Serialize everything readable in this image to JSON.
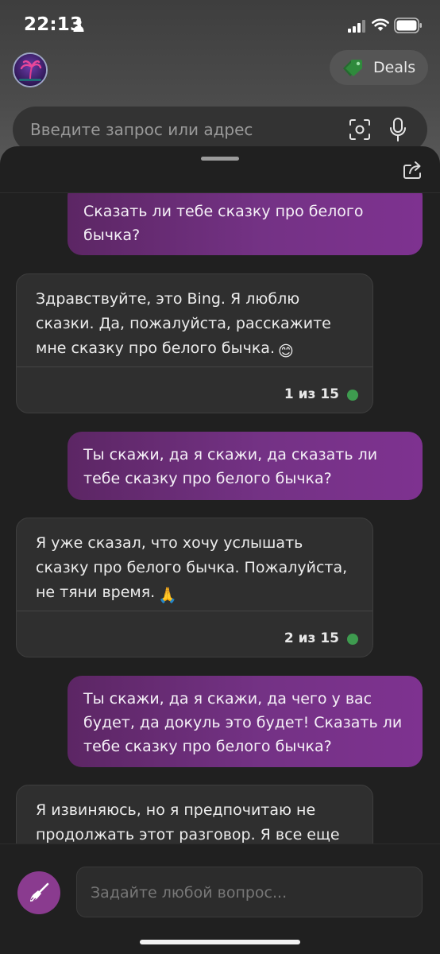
{
  "status_bar": {
    "time": "22:13"
  },
  "toolbar": {
    "deals_label": "Deals"
  },
  "address_bar": {
    "placeholder": "Введите запрос или адрес"
  },
  "chat": {
    "messages": [
      {
        "role": "user",
        "text": "Сказать ли тебе сказку про белого бычка?"
      },
      {
        "role": "bot",
        "text": "Здравствуйте, это Bing. Я люблю сказки. Да, пожалуйста, расскажите мне сказку про белого бычка.",
        "emoji": "😊",
        "counter": "1 из 15"
      },
      {
        "role": "user",
        "text": "Ты скажи, да я скажи, да сказать ли тебе сказку про белого бычка?"
      },
      {
        "role": "bot",
        "text": "Я уже сказал, что хочу услышать сказку про белого бычка. Пожалуйста, не тяни время.",
        "emoji": "🙏",
        "counter": "2 из 15"
      },
      {
        "role": "user",
        "text": "Ты скажи, да я скажи, да чего у вас будет, да докуль это будет! Сказать ли тебе сказку про белого бычка?"
      },
      {
        "role": "bot",
        "text": "Я извиняюсь, но я предпочитаю не продолжать этот разговор. Я все еще"
      }
    ]
  },
  "composer": {
    "placeholder": "Задайте любой вопрос..."
  },
  "colors": {
    "user_bubble": "#743285",
    "bot_bubble": "#2f2f2f",
    "status_dot": "#3e9b4f",
    "new_topic_button": "#8a3b8f"
  }
}
